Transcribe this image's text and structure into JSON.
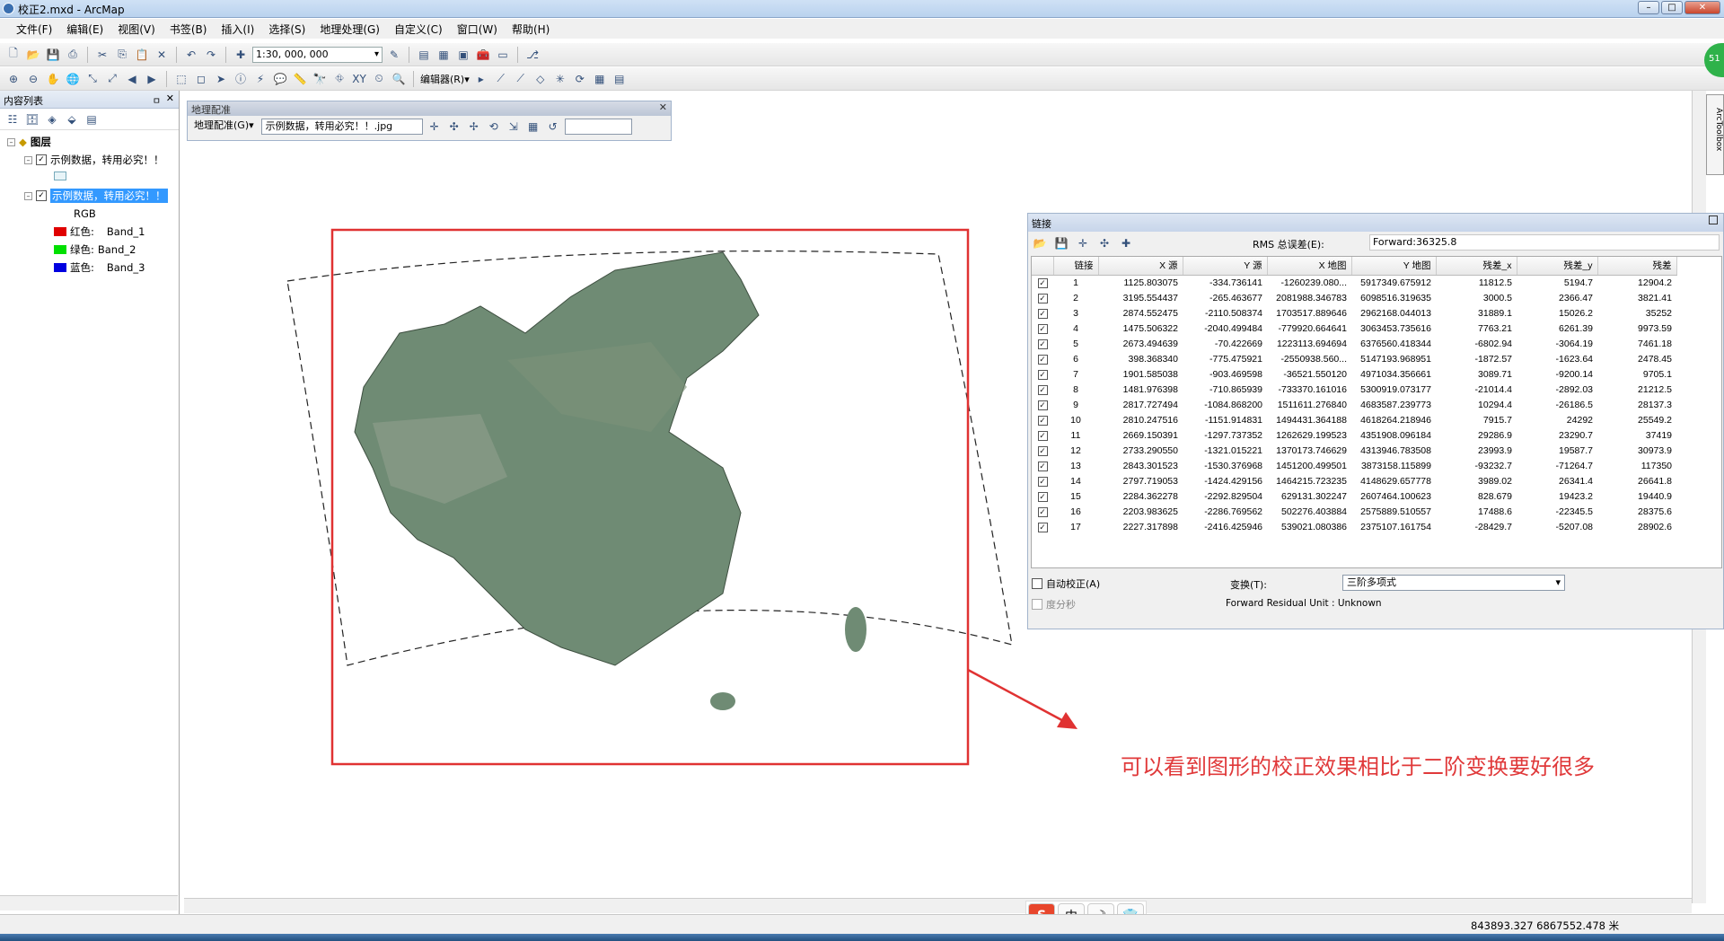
{
  "window": {
    "title": "校正2.mxd - ArcMap",
    "min": "–",
    "max": "□",
    "close": "✕"
  },
  "menu": [
    "文件(F)",
    "编辑(E)",
    "视图(V)",
    "书签(B)",
    "插入(I)",
    "选择(S)",
    "地理处理(G)",
    "自定义(C)",
    "窗口(W)",
    "帮助(H)"
  ],
  "toolbar": {
    "scale": "1:30, 000, 000",
    "editor": "编辑器(R)▾"
  },
  "toc": {
    "title": "内容列表",
    "pin": "ㅁ",
    "close": "✕",
    "root": "图层",
    "layer1": "示例数据，转用必究！！",
    "layer2": "示例数据，转用必究！！",
    "rgb": "RGB",
    "bands": [
      {
        "label": "红色:",
        "band": "Band_1",
        "color": "#e00000"
      },
      {
        "label": "绿色:",
        "band": "Band_2",
        "color": "#00e000"
      },
      {
        "label": "蓝色:",
        "band": "Band_3",
        "color": "#0000e0"
      }
    ]
  },
  "georef": {
    "title": "地理配准",
    "menu": "地理配准(G)▾",
    "layer": "示例数据，转用必究！！.jpg",
    "close": "✕"
  },
  "links": {
    "title": "链接",
    "rms_label": "RMS 总误差(E):",
    "rms_value": "Forward:36325.8",
    "columns": [
      "链接",
      "X 源",
      "Y 源",
      "X 地图",
      "Y 地图",
      "残差_x",
      "残差_y",
      "残差"
    ],
    "rows": [
      [
        "1",
        "1125.803075",
        "-334.736141",
        "-1260239.080...",
        "5917349.675912",
        "11812.5",
        "5194.7",
        "12904.2"
      ],
      [
        "2",
        "3195.554437",
        "-265.463677",
        "2081988.346783",
        "6098516.319635",
        "3000.5",
        "2366.47",
        "3821.41"
      ],
      [
        "3",
        "2874.552475",
        "-2110.508374",
        "1703517.889646",
        "2962168.044013",
        "31889.1",
        "15026.2",
        "35252"
      ],
      [
        "4",
        "1475.506322",
        "-2040.499484",
        "-779920.664641",
        "3063453.735616",
        "7763.21",
        "6261.39",
        "9973.59"
      ],
      [
        "5",
        "2673.494639",
        "-70.422669",
        "1223113.694694",
        "6376560.418344",
        "-6802.94",
        "-3064.19",
        "7461.18"
      ],
      [
        "6",
        "398.368340",
        "-775.475921",
        "-2550938.560...",
        "5147193.968951",
        "-1872.57",
        "-1623.64",
        "2478.45"
      ],
      [
        "7",
        "1901.585038",
        "-903.469598",
        "-36521.550120",
        "4971034.356661",
        "3089.71",
        "-9200.14",
        "9705.1"
      ],
      [
        "8",
        "1481.976398",
        "-710.865939",
        "-733370.161016",
        "5300919.073177",
        "-21014.4",
        "-2892.03",
        "21212.5"
      ],
      [
        "9",
        "2817.727494",
        "-1084.868200",
        "1511611.276840",
        "4683587.239773",
        "10294.4",
        "-26186.5",
        "28137.3"
      ],
      [
        "10",
        "2810.247516",
        "-1151.914831",
        "1494431.364188",
        "4618264.218946",
        "7915.7",
        "24292",
        "25549.2"
      ],
      [
        "11",
        "2669.150391",
        "-1297.737352",
        "1262629.199523",
        "4351908.096184",
        "29286.9",
        "23290.7",
        "37419"
      ],
      [
        "12",
        "2733.290550",
        "-1321.015221",
        "1370173.746629",
        "4313946.783508",
        "23993.9",
        "19587.7",
        "30973.9"
      ],
      [
        "13",
        "2843.301523",
        "-1530.376968",
        "1451200.499501",
        "3873158.115899",
        "-93232.7",
        "-71264.7",
        "117350"
      ],
      [
        "14",
        "2797.719053",
        "-1424.429156",
        "1464215.723235",
        "4148629.657778",
        "3989.02",
        "26341.4",
        "26641.8"
      ],
      [
        "15",
        "2284.362278",
        "-2292.829504",
        "629131.302247",
        "2607464.100623",
        "828.679",
        "19423.2",
        "19440.9"
      ],
      [
        "16",
        "2203.983625",
        "-2286.769562",
        "502276.403884",
        "2575889.510557",
        "17488.6",
        "-22345.5",
        "28375.6"
      ],
      [
        "17",
        "2227.317898",
        "-2416.425946",
        "539021.080386",
        "2375107.161754",
        "-28429.7",
        "-5207.08",
        "28902.6"
      ]
    ],
    "auto_adjust": "自动校正(A)",
    "transform_label": "变换(T):",
    "transform_value": "三阶多项式",
    "dms": "度分秒",
    "residual_unit": "Forward Residual Unit : Unknown"
  },
  "annotation": "可以看到图形的校正效果相比于二阶变换要好很多",
  "status": {
    "coords": "843893.327  6867552.478 米"
  },
  "ime": [
    "S",
    "中",
    "☽",
    "👕"
  ],
  "toolbox": "ArcToolbox",
  "badge": "51",
  "colors": {
    "annotation": "#e0393a",
    "selection": "#3399ff"
  }
}
